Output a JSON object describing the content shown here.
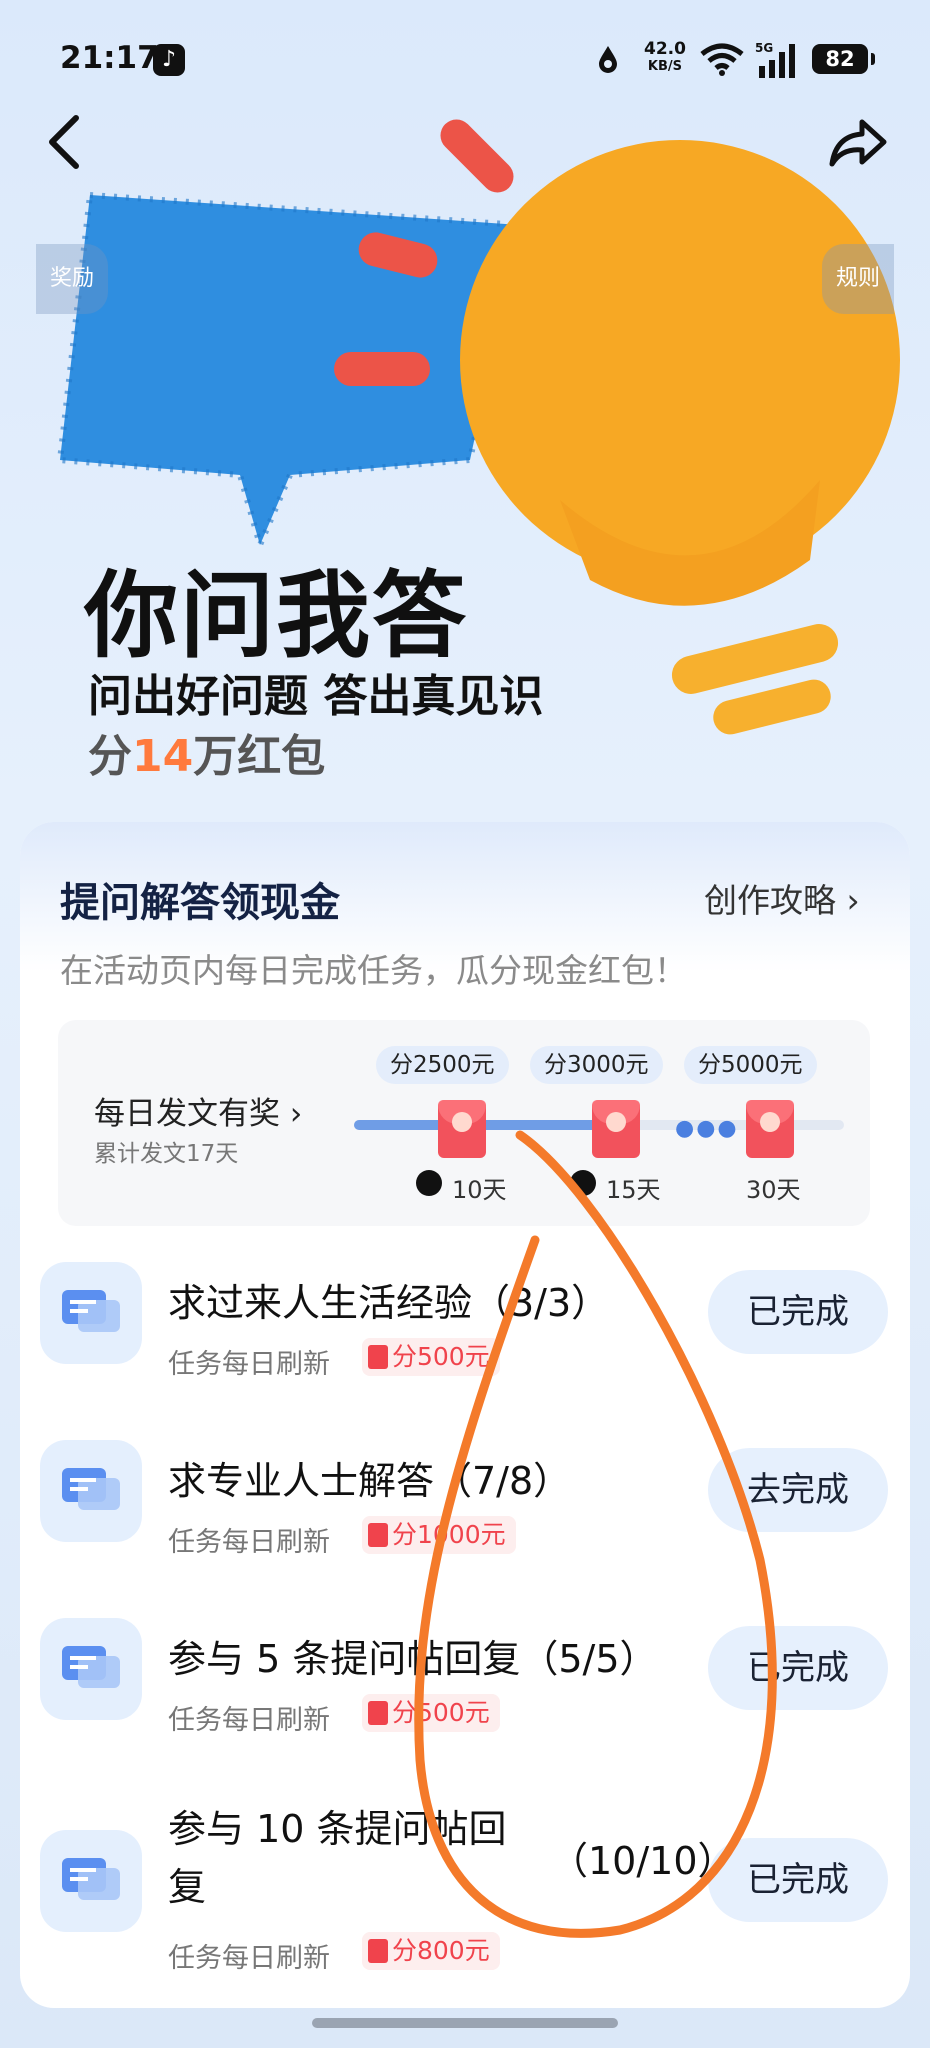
{
  "status_bar": {
    "time": "21:17",
    "net_speed_value": "42.0",
    "net_speed_unit": "KB/S",
    "signal": "5G",
    "battery": "82"
  },
  "nav": {
    "left_pill": "奖励",
    "right_pill": "规则"
  },
  "hero": {
    "title": "你问我答",
    "subtitle": "问出好问题 答出真见识",
    "prize_prefix": "分",
    "prize_number": "14",
    "prize_suffix": "万红包"
  },
  "card": {
    "title": "提问解答领现金",
    "guide_link": "创作攻略 ›",
    "description": "在活动页内每日完成任务，瓜分现金红包！",
    "daily": {
      "label": "每日发文有奖 ›",
      "sub": "累计发文17天",
      "milestones": [
        {
          "tag": "分2500元",
          "day": "10天"
        },
        {
          "tag": "分3000元",
          "day": "15天"
        },
        {
          "tag": "分5000元",
          "day": "30天"
        }
      ]
    },
    "tasks": [
      {
        "title": "求过来人生活经验（3/3）",
        "sub": "任务每日刷新",
        "reward": "分500元",
        "button": "已完成"
      },
      {
        "title": "求专业人士解答（7/8）",
        "sub": "任务每日刷新",
        "reward": "分1000元",
        "button": "去完成"
      },
      {
        "title": "参与 5 条提问帖回复（5/5）",
        "sub": "任务每日刷新",
        "reward": "分500元",
        "button": "已完成"
      },
      {
        "title": "参与 10 条提问帖回复",
        "progress": "（10/10）",
        "sub": "任务每日刷新",
        "reward": "分800元",
        "button": "已完成"
      }
    ]
  },
  "colors": {
    "accent_orange": "#ff7a3d",
    "reward_red": "#f0434c",
    "button_bg": "#e6f0fd",
    "progress_blue": "#6f9de6"
  }
}
